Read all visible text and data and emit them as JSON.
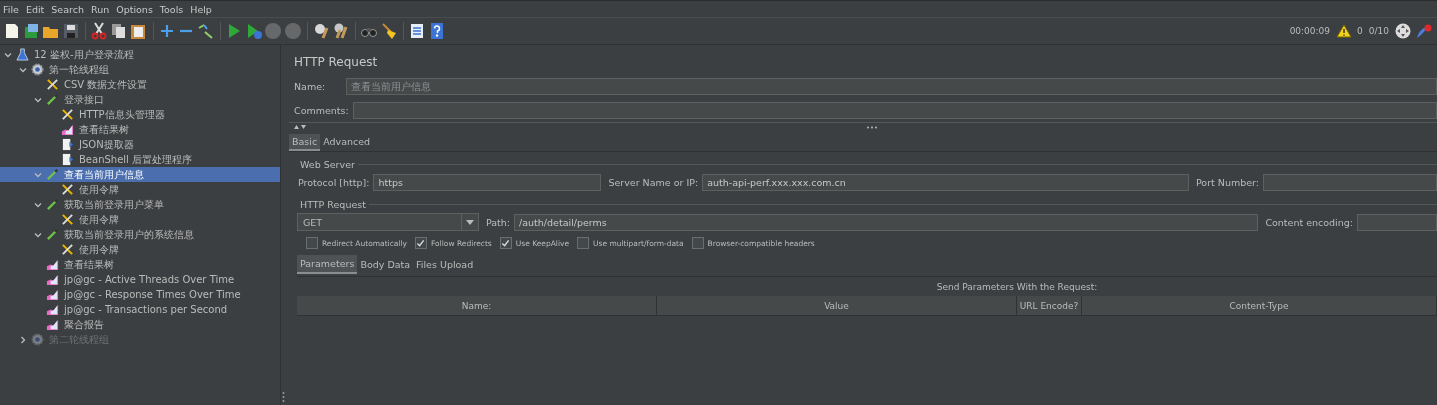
{
  "menu": [
    "File",
    "Edit",
    "Search",
    "Run",
    "Options",
    "Tools",
    "Help"
  ],
  "toolbar": [
    {
      "kind": "new",
      "disabled": false
    },
    {
      "kind": "templates",
      "disabled": false
    },
    {
      "kind": "open",
      "disabled": false
    },
    {
      "kind": "save",
      "disabled": false
    },
    {
      "kind": "separator"
    },
    {
      "kind": "cut",
      "disabled": false
    },
    {
      "kind": "copy",
      "disabled": false
    },
    {
      "kind": "paste",
      "disabled": false
    },
    {
      "kind": "separator"
    },
    {
      "kind": "expand",
      "disabled": false
    },
    {
      "kind": "collapse",
      "disabled": false
    },
    {
      "kind": "toggle",
      "disabled": false
    },
    {
      "kind": "separator"
    },
    {
      "kind": "start",
      "disabled": false
    },
    {
      "kind": "start_no_pause",
      "disabled": false
    },
    {
      "kind": "stop",
      "disabled": true
    },
    {
      "kind": "shutdown",
      "disabled": true
    },
    {
      "kind": "separator"
    },
    {
      "kind": "clear",
      "disabled": false
    },
    {
      "kind": "clear_all",
      "disabled": false
    },
    {
      "kind": "separator"
    },
    {
      "kind": "search",
      "disabled": false
    },
    {
      "kind": "reset_search",
      "disabled": false
    },
    {
      "kind": "separator"
    },
    {
      "kind": "function_helper",
      "disabled": false
    },
    {
      "kind": "help",
      "disabled": false
    }
  ],
  "status": {
    "timer": "00:00:09",
    "warnings": "0",
    "threads": "0/10"
  },
  "tree": [
    {
      "label": "12 鉴权-用户登录流程",
      "kind": "test_plan",
      "expanded": true,
      "selected": false,
      "disabled": false,
      "children": [
        {
          "label": "第一轮线程组",
          "kind": "thread_group",
          "expanded": true,
          "selected": false,
          "disabled": false,
          "children": [
            {
              "label": "CSV 数据文件设置",
              "kind": "config",
              "selected": false,
              "disabled": false
            },
            {
              "label": "登录接口",
              "kind": "sampler",
              "expanded": true,
              "selected": false,
              "disabled": false,
              "children": [
                {
                  "label": "HTTP信息头管理器",
                  "kind": "config",
                  "selected": false,
                  "disabled": false
                },
                {
                  "label": "查看结果树",
                  "kind": "listener",
                  "selected": false,
                  "disabled": false
                },
                {
                  "label": "JSON提取器",
                  "kind": "extractor",
                  "selected": false,
                  "disabled": false
                },
                {
                  "label": "BeanShell 后置处理程序",
                  "kind": "extractor",
                  "selected": false,
                  "disabled": false
                }
              ]
            },
            {
              "label": "查看当前用户信息",
              "kind": "sampler",
              "expanded": true,
              "selected": true,
              "disabled": false,
              "children": [
                {
                  "label": "使用令牌",
                  "kind": "config",
                  "selected": false,
                  "disabled": false
                }
              ]
            },
            {
              "label": "获取当前登录用户菜单",
              "kind": "sampler",
              "expanded": true,
              "selected": false,
              "disabled": false,
              "children": [
                {
                  "label": "使用令牌",
                  "kind": "config",
                  "selected": false,
                  "disabled": false
                }
              ]
            },
            {
              "label": "获取当前登录用户的系统信息",
              "kind": "sampler",
              "expanded": true,
              "selected": false,
              "disabled": false,
              "children": [
                {
                  "label": "使用令牌",
                  "kind": "config",
                  "selected": false,
                  "disabled": false
                }
              ]
            },
            {
              "label": "查看结果树",
              "kind": "listener",
              "selected": false,
              "disabled": false
            },
            {
              "label": "jp@gc - Active Threads Over Time",
              "kind": "listener",
              "selected": false,
              "disabled": false
            },
            {
              "label": "jp@gc - Response Times Over Time",
              "kind": "listener",
              "selected": false,
              "disabled": false
            },
            {
              "label": "jp@gc - Transactions per Second",
              "kind": "listener",
              "selected": false,
              "disabled": false
            },
            {
              "label": "聚合报告",
              "kind": "listener",
              "selected": false,
              "disabled": false
            }
          ]
        },
        {
          "label": "第二轮线程组",
          "kind": "thread_group",
          "expanded": false,
          "selected": false,
          "disabled": true
        }
      ]
    }
  ],
  "panel": {
    "title": "HTTP Request",
    "name_label": "Name:",
    "name_value": "查看当前用户信息",
    "comments_label": "Comments:",
    "tabs": [
      {
        "label": "Basic",
        "selected": true
      },
      {
        "label": "Advanced",
        "selected": false
      }
    ],
    "web_server": {
      "legend": "Web Server",
      "protocol_label": "Protocol [http]:",
      "protocol": "https",
      "server_label": "Server Name or IP:",
      "server": "auth-api-perf.xxx.xxx.com.cn",
      "port_label": "Port Number:"
    },
    "http_request": {
      "legend": "HTTP Request",
      "method": "GET",
      "path_label": "Path:",
      "path": "/auth/detail/perms",
      "encoding_label": "Content encoding:"
    },
    "options": [
      {
        "label": "Redirect Automatically",
        "checked": false
      },
      {
        "label": "Follow Redirects",
        "checked": true
      },
      {
        "label": "Use KeepAlive",
        "checked": true
      },
      {
        "label": "Use multipart/form-data",
        "checked": false
      },
      {
        "label": "Browser-compatible headers",
        "checked": false
      }
    ],
    "subtabs": [
      {
        "label": "Parameters",
        "selected": true
      },
      {
        "label": "Body Data",
        "selected": false
      },
      {
        "label": "Files Upload",
        "selected": false
      }
    ],
    "params_title": "Send Parameters With the Request:",
    "columns": [
      "Name:",
      "Value",
      "URL Encode?",
      "Content-Type"
    ]
  }
}
